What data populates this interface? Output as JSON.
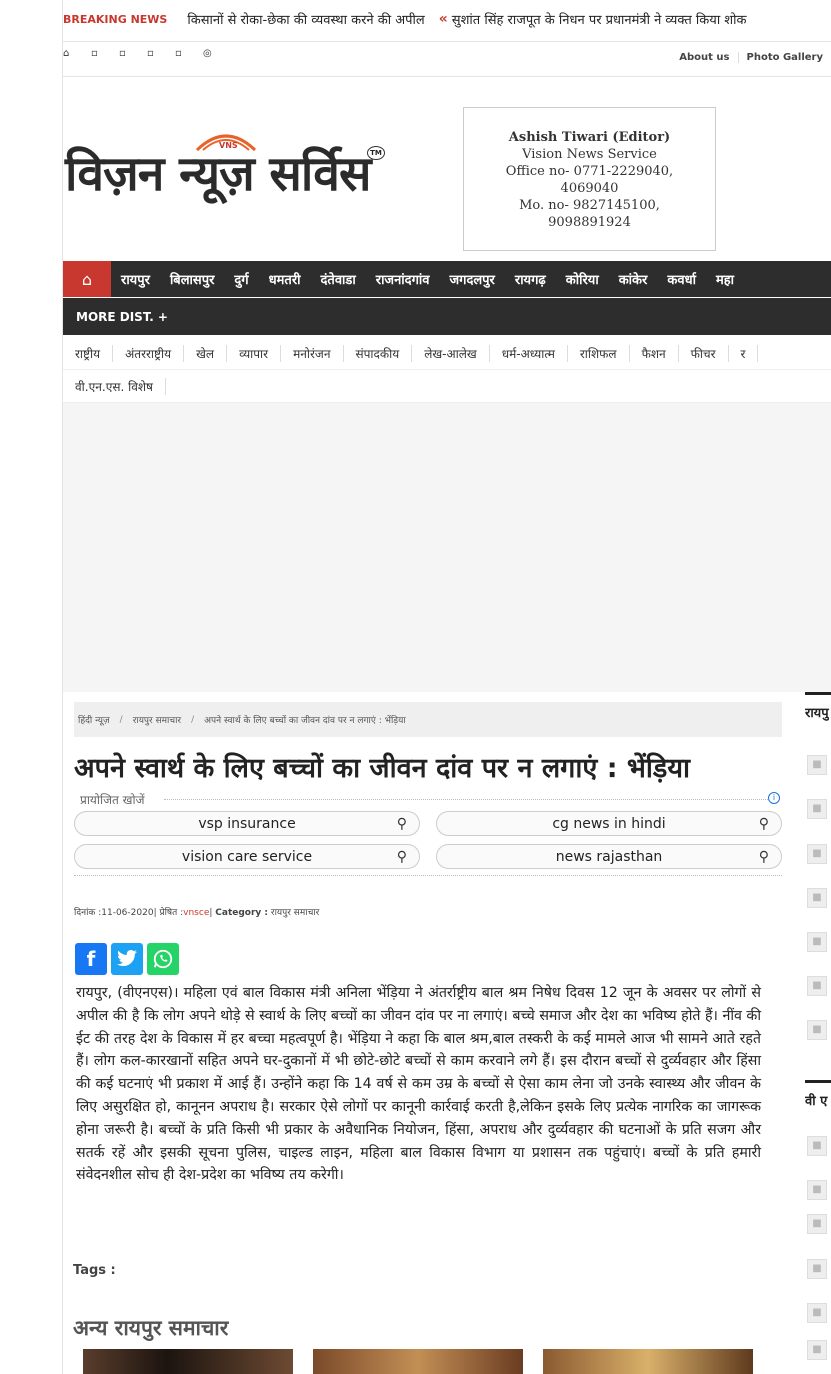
{
  "breaking": {
    "label": "BREAKING NEWS",
    "items": [
      "किसानों से रोका-छेका की व्यवस्था करने की अपील",
      "सुशांत सिंह राजपूत के निधन पर प्रधानमंत्री ने व्यक्त किया शोक"
    ]
  },
  "topbar": {
    "icons": [
      "home-icon",
      "facebook-icon",
      "twitter-icon",
      "instagram-icon",
      "youtube-icon",
      "whatsapp-icon"
    ],
    "links": [
      "About us",
      "Photo Gallery"
    ]
  },
  "logo": {
    "text": "विज़न न्यूज़ सर्विस",
    "tm": "TM",
    "mark": "VNS"
  },
  "editor": {
    "name": "Ashish Tiwari (Editor)",
    "org": "Vision News Service",
    "office": "Office no- 0771-2229040, 4069040",
    "mobile": "Mo. no- 9827145100, 9098891924"
  },
  "nav_districts": [
    "रायपुर",
    "बिलासपुर",
    "दुर्ग",
    "धमतरी",
    "दंतेवाडा",
    "राजनांदगांव",
    "जगदलपुर",
    "रायगढ़",
    "कोरिया",
    "कांकेर",
    "कवर्धा",
    "महा"
  ],
  "more_dist": "MORE DIST.  +",
  "nav_categories_row1": [
    "राष्ट्रीय",
    "अंतरराष्ट्रीय",
    "खेल",
    "व्यापार",
    "मनोरंजन",
    "संपादकीय",
    "लेख-आलेख",
    "धर्म-अध्यात्म",
    "राशिफल",
    "फैशन",
    "फीचर",
    "र"
  ],
  "nav_categories_row2": [
    "वी.एन.एस. विशेष"
  ],
  "breadcrumb": [
    "हिंदी न्यूज़",
    "रायपुर समाचार",
    "अपने स्वार्थ के लिए बच्चों का जीवन दांव पर न लगाएं : भेंड़िया"
  ],
  "article": {
    "title": "अपने स्वार्थ के लिए बच्चों का जीवन दांव पर न लगाएं : भेंड़िया",
    "date_label": "दिनांक :",
    "date": "11-06-2020",
    "by_label": "प्रेषित :",
    "by": "vnsce",
    "category_label": "Category :",
    "category": "रायपुर समाचार",
    "body": "रायपुर, (वीएनएस)। महिला एवं बाल विकास मंत्री अनिला भेंड़िया ने अंतर्राष्ट्रीय बाल श्रम निषेध दिवस 12 जून के अवसर पर लोगों से अपील की है कि लोग अपने थोड़े से स्वार्थ के लिए बच्चों का जीवन दांव पर ना लगाएं। बच्चे समाज और देश का भविष्य होते हैं। नींव की ईट की तरह देश के विकास में हर बच्चा महत्वपूर्ण है। भेंड़िया ने कहा कि बाल श्रम,बाल तस्करी के कई मामले आज भी सामने आते रहते हैं। लोग कल-कारखानों सहित अपने घर-दुकानों में भी छोटे-छोटे बच्चों से काम करवाने लगे हैं। इस दौरान बच्चों से दुर्व्यवहार और हिंसा की कई घटनाएं भी प्रकाश में आई हैं। उन्होंने कहा कि 14 वर्ष से कम उम्र के बच्चों से ऐसा काम लेना जो उनके स्वास्थ्य और जीवन के लिए असुरक्षित हो, कानूनन अपराध है। सरकार ऐसे लोगों पर कानूनी कार्रवाई करती है,लेकिन इसके लिए प्रत्येक नागरिक का जागरूक होना जरूरी है। बच्चों के प्रति किसी भी प्रकार के अवैधानिक नियोजन, हिंसा, अपराध और दुर्व्यवहार की घटनाओं के प्रति सजग और सतर्क रहें और इसकी सूचना पुलिस, चाइल्ड लाइन, महिला बाल विकास विभाग या प्रशासन तक पहुंचाएं। बच्चों के प्रति हमारी संवेदनशील सोच ही देश-प्रदेश का भविष्य तय करेगी।",
    "tags_label": "Tags :"
  },
  "sponsored": {
    "heading": "प्रायोजित खोजें",
    "searches": [
      "vsp insurance",
      "cg news in hindi",
      "vision care service",
      "news rajasthan"
    ]
  },
  "share": [
    "facebook-share",
    "twitter-share",
    "whatsapp-share"
  ],
  "more_news": "अन्य रायपुर समाचार",
  "sidebar": {
    "headers": [
      "रायपु",
      "वी ए"
    ]
  },
  "colors": {
    "accent": "#c8382e",
    "nav_bg": "#2d2d2d"
  }
}
